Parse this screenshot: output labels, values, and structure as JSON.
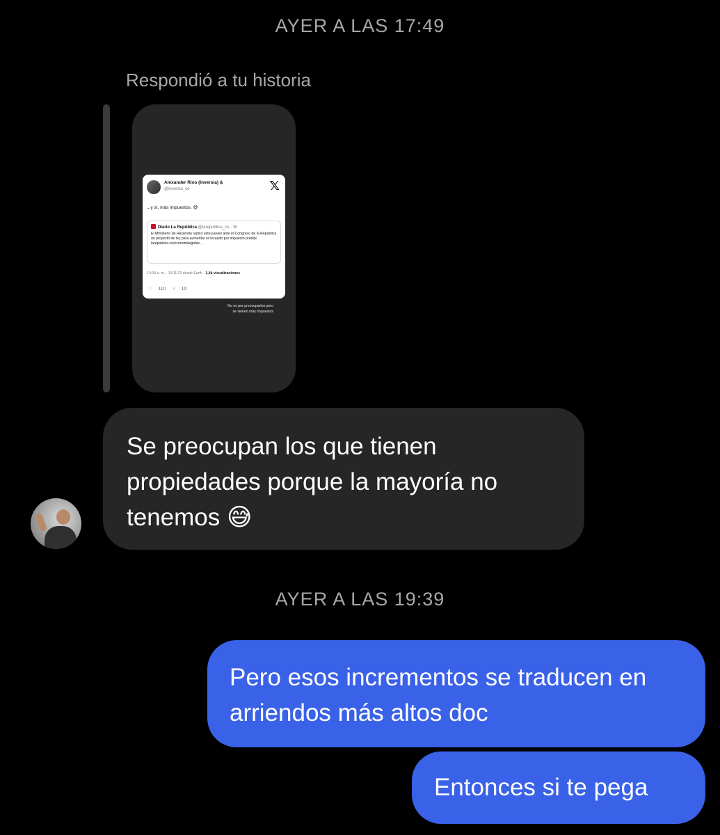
{
  "timestamps": {
    "first": "AYER A LAS 17:49",
    "second": "AYER A LAS 19:39"
  },
  "story_reply": {
    "label": "Respondió a tu historia",
    "tweet": {
      "author": "Alexander Rios (Inversia) &",
      "handle": "@inversia_co",
      "x_logo": "𝕏",
      "text": "...y sí, más impuestos. 😅",
      "quote": {
        "source": "Diario La República",
        "handle": "@larepublica_co · 3h",
        "text": "El Ministerio de Hacienda radicó este jueves ante el Congreso de la República un proyecto de ley para aumentar el recaudo por impuesto predial larepublica.co/economia/gobie..."
      },
      "meta": "10:39 a. m. · 10/11/23 desde Earth ·",
      "views": "1,4k visualizaciones",
      "likes": "110",
      "replies": "10",
      "like_icon": "heart-icon",
      "reply_icon": "comment-icon"
    },
    "caption_line_1": "No es por preocuparlos pero",
    "caption_line_2": "se vienen más impuestos"
  },
  "messages": {
    "incoming_1": "Se preocupan los que tienen propiedades porque la mayoría no tenemos 😅",
    "outgoing_1": "Pero esos incrementos se traducen en arriendos más altos doc",
    "outgoing_2": "Entonces si te pega"
  },
  "colors": {
    "background": "#000000",
    "incoming_bubble": "#262626",
    "outgoing_bubble": "#3a62e8",
    "muted_text": "#a8a8a8"
  }
}
